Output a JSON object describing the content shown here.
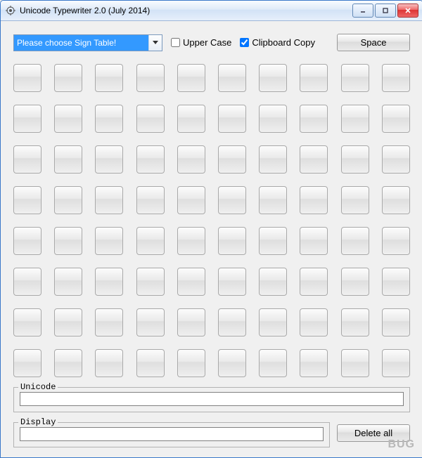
{
  "window": {
    "title": "Unicode Typewriter 2.0 (July 2014)",
    "icon_name": "app-icon"
  },
  "controls": {
    "sign_table_placeholder": "Please choose Sign Table!",
    "upper_case_label": "Upper Case",
    "upper_case_checked": false,
    "clipboard_copy_label": "Clipboard Copy",
    "clipboard_copy_checked": true,
    "space_button": "Space",
    "delete_all_button": "Delete all"
  },
  "grid": {
    "rows": 8,
    "cols": 10
  },
  "fields": {
    "unicode_label": "Unicode",
    "unicode_value": "",
    "display_label": "Display",
    "display_value": ""
  },
  "watermark": "BUG"
}
